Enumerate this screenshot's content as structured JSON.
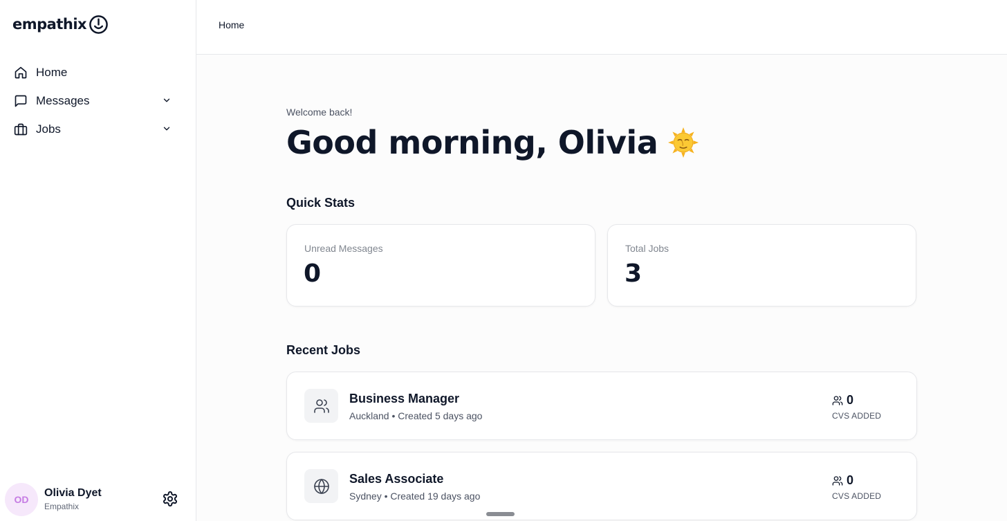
{
  "brand": {
    "name": "empathix"
  },
  "sidebar": {
    "items": [
      {
        "label": "Home",
        "icon": "home-icon"
      },
      {
        "label": "Messages",
        "icon": "message-square-icon",
        "expandable": true
      },
      {
        "label": "Jobs",
        "icon": "briefcase-icon",
        "expandable": true
      }
    ]
  },
  "profile": {
    "initials": "OD",
    "name": "Olivia Dyet",
    "org": "Empathix"
  },
  "header": {
    "breadcrumb": "Home"
  },
  "main": {
    "welcome": "Welcome back!",
    "greeting": "Good morning, Olivia",
    "quick_stats_title": "Quick Stats",
    "stats": [
      {
        "label": "Unread Messages",
        "value": "0"
      },
      {
        "label": "Total Jobs",
        "value": "3"
      }
    ],
    "recent_jobs_title": "Recent Jobs",
    "jobs": [
      {
        "title": "Business Manager",
        "meta": "Auckland • Created 5 days ago",
        "count": "0",
        "count_label": "CVS ADDED",
        "icon": "users-icon"
      },
      {
        "title": "Sales Associate",
        "meta": "Sydney • Created 19 days ago",
        "count": "0",
        "count_label": "CVS ADDED",
        "icon": "globe-icon"
      }
    ]
  },
  "colors": {
    "text": "#0f1729",
    "muted": "#80868f",
    "avatar_bg": "#f6e8fb",
    "avatar_text": "#c57be3",
    "border": "#e6e7ea"
  }
}
